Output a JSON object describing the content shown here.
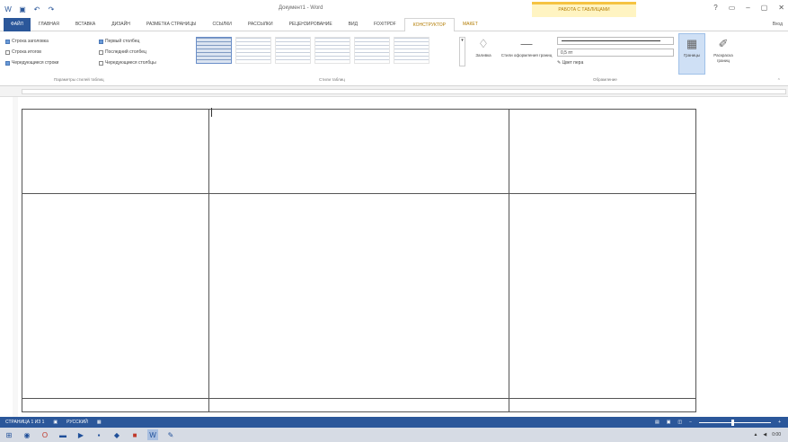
{
  "title_bar": {
    "document_title": "Документ1 - Word",
    "context_title": "РАБОТА С ТАБЛИЦАМИ",
    "qat_icons": [
      "word-logo-icon",
      "save-icon",
      "undo-icon",
      "redo-icon"
    ]
  },
  "tabs": [
    {
      "label": "ФАЙЛ",
      "type": "file"
    },
    {
      "label": "ГЛАВНАЯ",
      "type": "normal"
    },
    {
      "label": "ВСТАВКА",
      "type": "normal"
    },
    {
      "label": "ДИЗАЙН",
      "type": "normal"
    },
    {
      "label": "РАЗМЕТКА СТРАНИЦЫ",
      "type": "normal"
    },
    {
      "label": "ССЫЛКИ",
      "type": "normal"
    },
    {
      "label": "РАССЫЛКИ",
      "type": "normal"
    },
    {
      "label": "РЕЦЕНЗИРОВАНИЕ",
      "type": "normal"
    },
    {
      "label": "ВИД",
      "type": "normal"
    },
    {
      "label": "FOXITPDF",
      "type": "normal"
    },
    {
      "label": "КОНСТРУКТОР",
      "type": "active"
    },
    {
      "label": "МАКЕТ",
      "type": "ctx"
    }
  ],
  "user": "Вход",
  "ribbon": {
    "style_options": {
      "checkboxes": [
        {
          "label": "Строка заголовка",
          "checked": true
        },
        {
          "label": "Первый столбец",
          "checked": true
        },
        {
          "label": "Строка итогов",
          "checked": false
        },
        {
          "label": "Последний столбец",
          "checked": false
        },
        {
          "label": "Чередующиеся строки",
          "checked": true
        },
        {
          "label": "Чередующиеся столбцы",
          "checked": false
        }
      ],
      "group_label": "Параметры стилей таблиц"
    },
    "table_styles": {
      "group_label": "Стили таблиц"
    },
    "shading_label": "Заливка",
    "border_styles_label": "Стили оформления границ",
    "line_weight": "0,5 пт",
    "pen_color_label": "Цвет пера",
    "borders_label": "Границы",
    "border_painter_label": "Раскраска границ",
    "borders_group_label": "Обрамление"
  },
  "statusbar": {
    "page_info": "СТРАНИЦА 1 ИЗ 1",
    "language": "РУССКИЙ"
  },
  "taskbar": {
    "icons": [
      "windows-start-icon",
      "chrome-icon",
      "opera-icon",
      "folder-icon",
      "media-icon",
      "terminal-icon",
      "app-icon",
      "app-red-icon",
      "word-taskbar-icon",
      "paint-icon"
    ],
    "clock": "0:00"
  }
}
